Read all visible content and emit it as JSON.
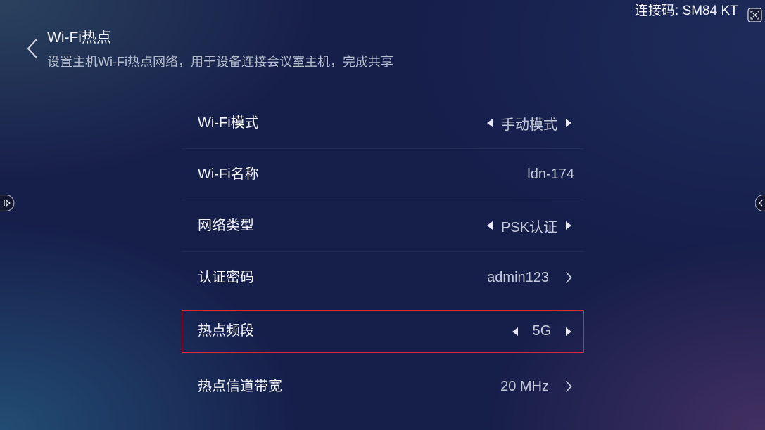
{
  "status_bar": {
    "connection_code": "连接码: SM84 KT",
    "corner_icon": "close-window-icon"
  },
  "header": {
    "title": "Wi-Fi热点",
    "subtitle": "设置主机Wi-Fi热点网络，用于设备连接会议室主机，完成共享",
    "back_icon": "chevron-left-icon"
  },
  "side_handles": {
    "left_icon": "expand-panel-right-icon",
    "right_icon": "expand-panel-left-icon"
  },
  "settings": [
    {
      "label": "Wi-Fi模式",
      "value": "手动模式",
      "icons": [
        "caret-left-icon",
        "caret-right-icon"
      ]
    },
    {
      "label": "Wi-Fi名称",
      "value": "ldn-174"
    },
    {
      "label": "网络类型",
      "value": "PSK认证",
      "icons": [
        "caret-left-icon",
        "caret-right-icon"
      ]
    },
    {
      "label": "认证密码",
      "value": "admin123",
      "icons": [
        "chevron-right-icon"
      ]
    },
    {
      "label": "热点频段",
      "value": "5G",
      "icons": [
        "caret-left-icon",
        "caret-right-icon"
      ],
      "focused": true
    },
    {
      "label": "热点信道带宽",
      "value": "20 MHz",
      "icons": [
        "chevron-right-icon"
      ]
    }
  ],
  "colors": {
    "background": "#161e4a",
    "focus_border": "#d3293b",
    "label_text": "#f4f6fb",
    "value_text": "#c3c9d8"
  }
}
